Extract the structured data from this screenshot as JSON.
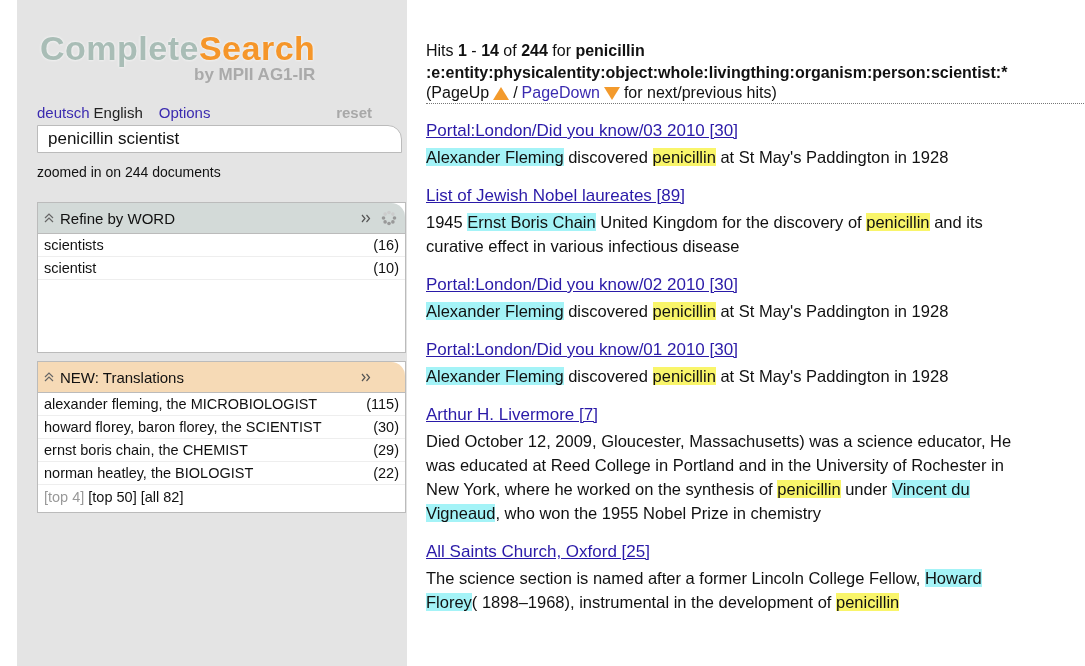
{
  "logo": {
    "word_1": "Complete",
    "word_2": "Search",
    "byline": "by MPII AG1-IR"
  },
  "languages": [
    {
      "label": "deutsch",
      "selected": false
    },
    {
      "label": "English",
      "selected": true
    }
  ],
  "options_link": "Options",
  "reset_link": {
    "label": "reset",
    "disabled": true
  },
  "search": {
    "value": "penicillin scientist"
  },
  "zoom_status": "zoomed in on 244 documents",
  "panels": [
    {
      "title": "Refine by WORD",
      "kind": "word",
      "busy": true,
      "items": [
        {
          "label": "scientists",
          "count": "(16)"
        },
        {
          "label": "scientist",
          "count": "(10)"
        }
      ]
    },
    {
      "title": "NEW: Translations",
      "kind": "new",
      "busy": false,
      "items": [
        {
          "label": "alexander fleming, the MICROBIOLOGIST",
          "count": "(115)"
        },
        {
          "label": "howard florey, baron florey, the SCIENTIST",
          "count": "(30)"
        },
        {
          "label": "ernst boris chain, the CHEMIST",
          "count": "(29)"
        },
        {
          "label": "norman heatley, the BIOLOGIST",
          "count": "(22)"
        }
      ],
      "more": [
        {
          "label": "[top 4]",
          "selected": true
        },
        {
          "label": "[top 50]",
          "selected": false
        },
        {
          "label": "[all 82]",
          "selected": false
        }
      ]
    }
  ],
  "summary": [
    {
      "text": "Hits ",
      "bold": false
    },
    {
      "text": "1",
      "bold": true
    },
    {
      "text": " - ",
      "bold": false
    },
    {
      "text": "14",
      "bold": true
    },
    {
      "text": " of ",
      "bold": false
    },
    {
      "text": "244",
      "bold": true
    },
    {
      "text": " for ",
      "bold": false
    },
    {
      "text": "penicillin :e:entity:physicalentity:object:whole:livingthing:organism:person:scientist:*",
      "bold": true
    }
  ],
  "paging": {
    "open": "(PageUp",
    "separator": "/",
    "page_down": "PageDown",
    "tail": "for next/previous hits)"
  },
  "results": [
    {
      "title": "Portal:London/Did you know/03 2010 [30]",
      "snippet": [
        {
          "kind": "entity",
          "text": "Alexander Fleming"
        },
        {
          "kind": "plain",
          "text": " discovered "
        },
        {
          "kind": "term",
          "text": "penicillin"
        },
        {
          "kind": "plain",
          "text": " at St May's Paddington in 1928"
        }
      ]
    },
    {
      "title": "List of Jewish Nobel laureates [89]",
      "snippet": [
        {
          "kind": "plain",
          "text": "1945 "
        },
        {
          "kind": "entity",
          "text": "Ernst Boris Chain"
        },
        {
          "kind": "plain",
          "text": " United Kingdom for the discovery of "
        },
        {
          "kind": "term",
          "text": "penicillin"
        },
        {
          "kind": "plain",
          "text": " and its curative effect in various infectious disease"
        }
      ]
    },
    {
      "title": "Portal:London/Did you know/02 2010 [30]",
      "snippet": [
        {
          "kind": "entity",
          "text": "Alexander Fleming"
        },
        {
          "kind": "plain",
          "text": " discovered "
        },
        {
          "kind": "term",
          "text": "penicillin"
        },
        {
          "kind": "plain",
          "text": " at St May's Paddington in 1928"
        }
      ]
    },
    {
      "title": "Portal:London/Did you know/01 2010 [30]",
      "snippet": [
        {
          "kind": "entity",
          "text": "Alexander Fleming"
        },
        {
          "kind": "plain",
          "text": " discovered "
        },
        {
          "kind": "term",
          "text": "penicillin"
        },
        {
          "kind": "plain",
          "text": " at St May's Paddington in 1928"
        }
      ]
    },
    {
      "title": "Arthur H. Livermore [7]",
      "snippet": [
        {
          "kind": "plain",
          "text": "Died October 12, 2009, Gloucester, Massachusetts) was a science educator, He was educated at Reed College in Portland and in the University of Rochester in New York, where he worked on the synthesis of "
        },
        {
          "kind": "term",
          "text": "penicillin"
        },
        {
          "kind": "plain",
          "text": " under "
        },
        {
          "kind": "entity",
          "text": "Vincent du Vigneaud"
        },
        {
          "kind": "plain",
          "text": ", who won the 1955 Nobel Prize in chemistry"
        }
      ]
    },
    {
      "title": "All Saints Church, Oxford [25]",
      "snippet": [
        {
          "kind": "plain",
          "text": "The science section is named after a former Lincoln College Fellow, "
        },
        {
          "kind": "entity",
          "text": "Howard Florey"
        },
        {
          "kind": "plain",
          "text": "( 1898–1968), instrumental in the development of "
        },
        {
          "kind": "term",
          "text": "penicillin"
        }
      ]
    }
  ]
}
